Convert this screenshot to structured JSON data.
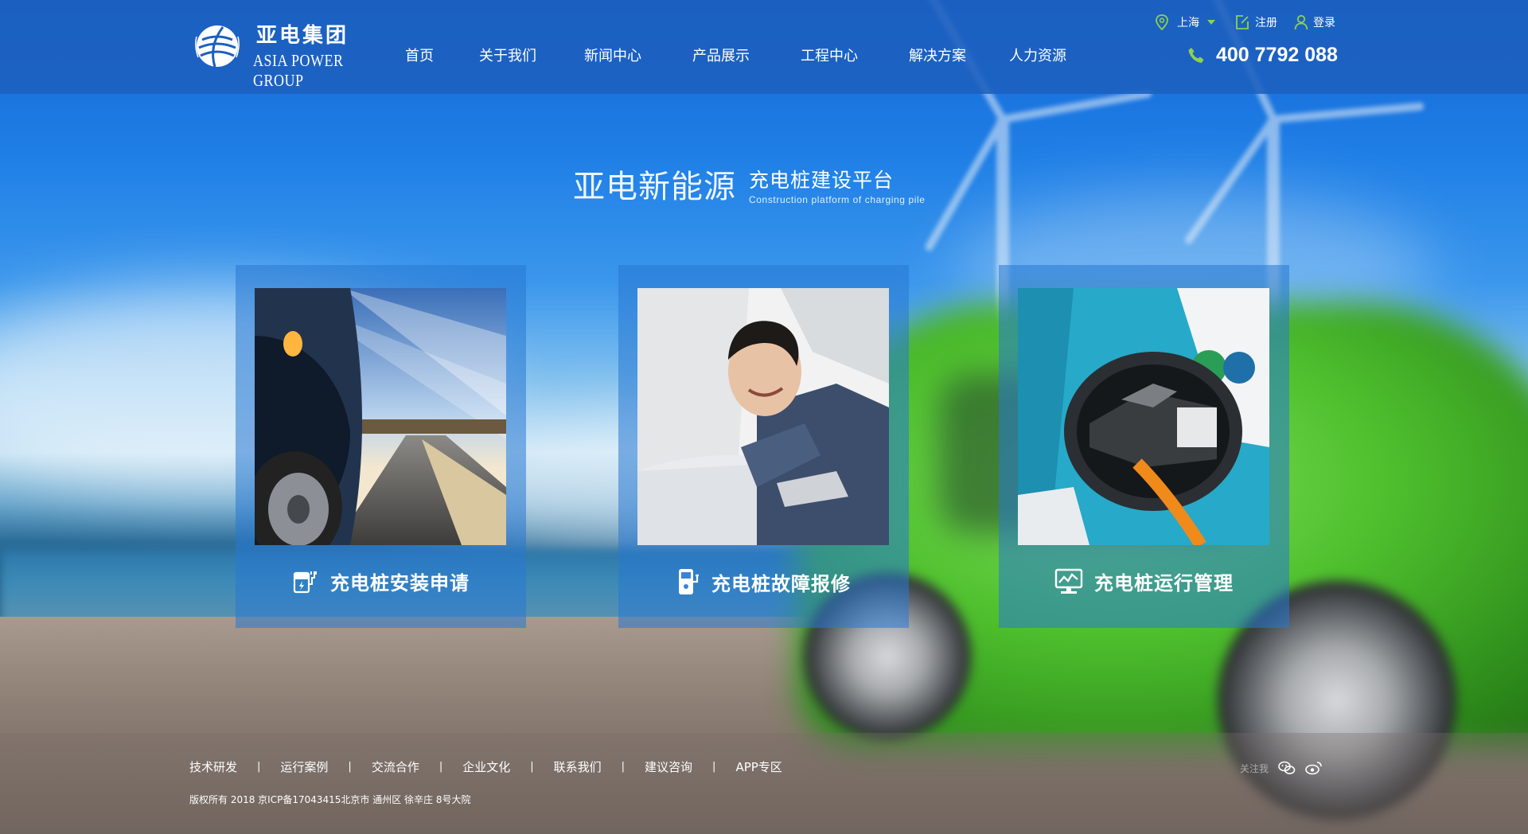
{
  "header": {
    "logo_cn": "亚电集团",
    "logo_en": "ASIA POWER GROUP",
    "nav": [
      {
        "label": "首页"
      },
      {
        "label": "关于我们"
      },
      {
        "label": "新闻中心"
      },
      {
        "label": "产品展示"
      },
      {
        "label": "工程中心"
      },
      {
        "label": "解决方案"
      },
      {
        "label": "人力资源"
      }
    ],
    "city": "上海",
    "register": "注册",
    "login": "登录",
    "hotline": "400 7792 088"
  },
  "hero": {
    "main": "亚电新能源",
    "sub_cn": "充电桩建设平台",
    "sub_en": "Construction platform of charging pile"
  },
  "cards": [
    {
      "label": "充电桩安装申请",
      "icon": "charging-station-icon"
    },
    {
      "label": "充电桩故障报修",
      "icon": "repair-icon"
    },
    {
      "label": "充电桩运行管理",
      "icon": "monitor-chart-icon"
    }
  ],
  "carousel": {
    "total": 3,
    "active": 1
  },
  "footer": {
    "links": [
      {
        "label": "技术研发"
      },
      {
        "label": "运行案例"
      },
      {
        "label": "交流合作"
      },
      {
        "label": "企业文化"
      },
      {
        "label": "联系我们"
      },
      {
        "label": "建议咨询"
      },
      {
        "label": "APP专区"
      }
    ],
    "separator": "|",
    "copyright": "版权所有 2018 京ICP备17043415北京市 通州区 徐辛庄 8号大院",
    "follow": "关注我"
  },
  "colors": {
    "header_bg": "#1c60be",
    "accent_green": "#8fd14f",
    "card_bg": "#2878d2"
  }
}
